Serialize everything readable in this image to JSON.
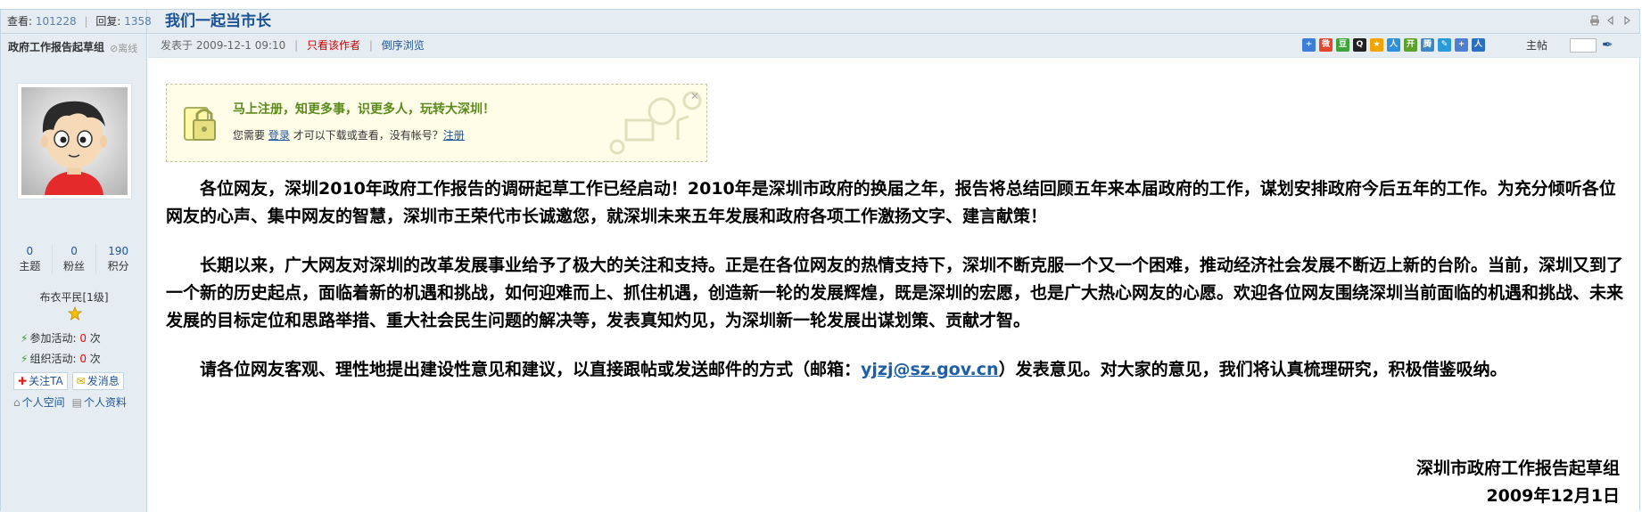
{
  "header": {
    "views_label": "查看:",
    "views": "101228",
    "replies_label": "回复:",
    "replies": "1358",
    "thread_title": "我们一起当市长",
    "print_icon": "print-icon",
    "prev_icon": "prev-icon",
    "next_icon": "next-icon"
  },
  "author": {
    "name": "政府工作报告起草组",
    "status": "离线",
    "stats": [
      {
        "value": "0",
        "label": "主题"
      },
      {
        "value": "0",
        "label": "粉丝"
      },
      {
        "value": "190",
        "label": "积分"
      }
    ],
    "rank": "布衣平民[1级]",
    "activities": [
      {
        "label": "参加活动:",
        "count": "0",
        "unit": "次"
      },
      {
        "label": "组织活动:",
        "count": "0",
        "unit": "次"
      }
    ],
    "follow_label": "关注TA",
    "message_label": "发消息",
    "space_label": "个人空间",
    "profile_label": "个人资料"
  },
  "postbar": {
    "posted": "发表于 2009-12-1 09:10",
    "only_author": "只看该作者",
    "reverse": "倒序浏览",
    "floor_label": "主帖",
    "share_colors": [
      "#3b7dd8",
      "#e8452c",
      "#3da33a",
      "#222222",
      "#f2a400",
      "#2f8fd8",
      "#5ea02e",
      "#3b88c3",
      "#2a9ad8",
      "#4f7fd0",
      "#2b6fc0"
    ]
  },
  "notice": {
    "headline": "马上注册，知更多事，识更多人，玩转大深圳！",
    "prefix": "您需要",
    "login": "登录",
    "middle": "才可以下载或查看，没有帐号？",
    "register": "注册"
  },
  "post": {
    "p1": "各位网友，深圳2010年政府工作报告的调研起草工作已经启动！2010年是深圳市政府的换届之年，报告将总结回顾五年来本届政府的工作，谋划安排政府今后五年的工作。为充分倾听各位网友的心声、集中网友的智慧，深圳市王荣代市长诚邀您，就深圳未来五年发展和政府各项工作激扬文字、建言献策！",
    "p2": "长期以来，广大网友对深圳的改革发展事业给予了极大的关注和支持。正是在各位网友的热情支持下，深圳不断克服一个又一个困难，推动经济社会发展不断迈上新的台阶。当前，深圳又到了一个新的历史起点，面临着新的机遇和挑战，如何迎难而上、抓住机遇，创造新一轮的发展辉煌，既是深圳的宏愿，也是广大热心网友的心愿。欢迎各位网友围绕深圳当前面临的机遇和挑战、未来发展的目标定位和思路举措、重大社会民生问题的解决等，发表真知灼见，为深圳新一轮发展出谋划策、贡献才智。",
    "p3_before": "请各位网友客观、理性地提出建设性意见和建议，以直接跟帖或发送邮件的方式（邮箱：",
    "email": "yjzj@sz.gov.cn",
    "p3_after": "）发表意见。对大家的意见，我们将认真梳理研究，积极借鉴吸纳。",
    "sign_org": "深圳市政府工作报告起草组",
    "sign_date": "2009年12月1日"
  }
}
